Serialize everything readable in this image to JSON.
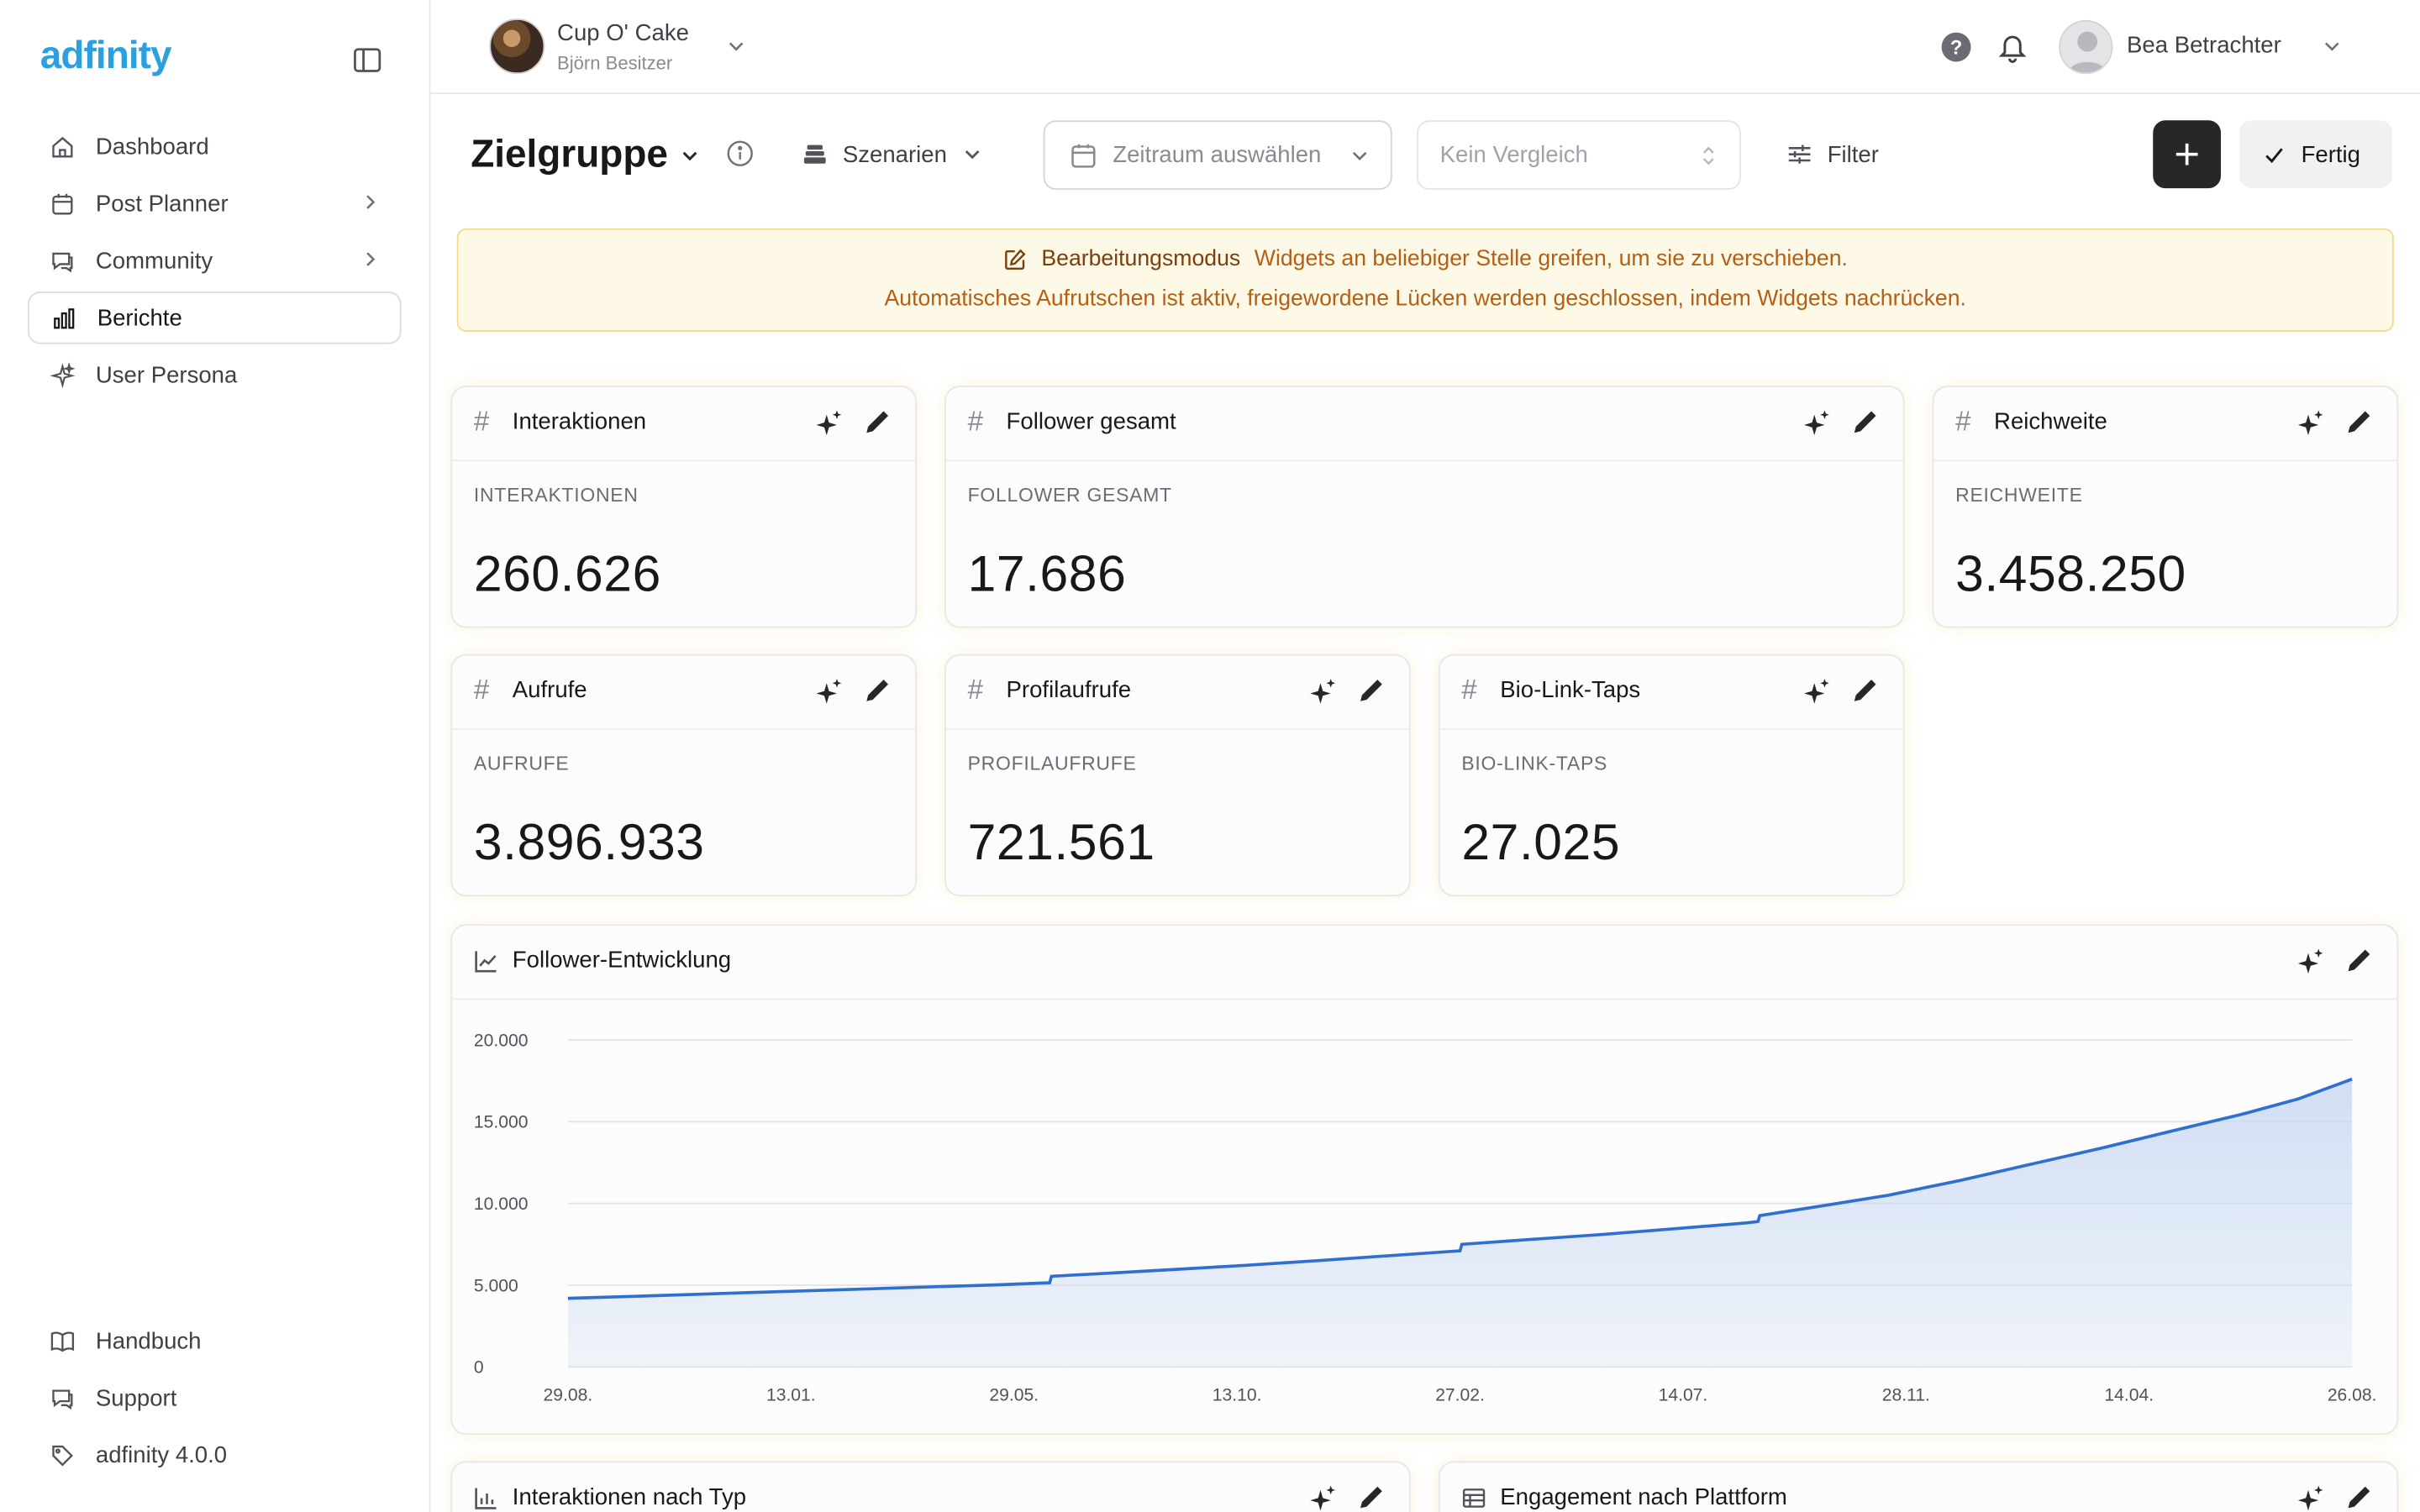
{
  "app": {
    "logo": "adfinity"
  },
  "sidebar": {
    "items": [
      {
        "label": "Dashboard",
        "icon": "home-icon"
      },
      {
        "label": "Post Planner",
        "icon": "calendar-icon"
      },
      {
        "label": "Community",
        "icon": "chat-icon"
      },
      {
        "label": "Berichte",
        "icon": "bar-chart-icon",
        "active": true
      },
      {
        "label": "User Persona",
        "icon": "sparkles-icon"
      }
    ],
    "bottom": [
      {
        "label": "Handbuch",
        "icon": "book-icon"
      },
      {
        "label": "Support",
        "icon": "chat-icon"
      },
      {
        "label": "adfinity 4.0.0",
        "icon": "tag-icon"
      }
    ]
  },
  "topbar": {
    "brand_name": "Cup O' Cake",
    "brand_owner": "Björn Besitzer",
    "help_symbol": "?",
    "user_name": "Bea Betrachter"
  },
  "toolbar": {
    "title": "Zielgruppe",
    "scenarios_label": "Szenarien",
    "range_placeholder": "Zeitraum auswählen",
    "compare_placeholder": "Kein Vergleich",
    "filter_label": "Filter",
    "done_label": "Fertig"
  },
  "banner": {
    "mode_label": "Bearbeitungsmodus",
    "line1": "Widgets an beliebiger Stelle greifen, um sie zu verschieben.",
    "line2": "Automatisches Aufrutschen ist aktiv, freigewordene Lücken werden geschlossen, indem Widgets nachrücken."
  },
  "metrics": [
    {
      "title": "Interaktionen",
      "label": "INTERAKTIONEN",
      "value": "260.626"
    },
    {
      "title": "Follower gesamt",
      "label": "FOLLOWER GESAMT",
      "value": "17.686"
    },
    {
      "title": "Reichweite",
      "label": "REICHWEITE",
      "value": "3.458.250"
    },
    {
      "title": "Aufrufe",
      "label": "AUFRUFE",
      "value": "3.896.933"
    },
    {
      "title": "Profilaufrufe",
      "label": "PROFILAUFRUFE",
      "value": "721.561"
    },
    {
      "title": "Bio-Link-Taps",
      "label": "BIO-LINK-TAPS",
      "value": "27.025"
    }
  ],
  "hash_symbol": "#",
  "follower_chart": {
    "title": "Follower-Entwicklung"
  },
  "bottom_widgets": [
    {
      "title": "Interaktionen nach Typ"
    },
    {
      "title": "Engagement nach Plattform"
    }
  ],
  "colors": {
    "accent": "#2f6fd0",
    "area_fill": "#c9d9f2",
    "banner_bg": "#fef9e6",
    "banner_text": "#b45f16",
    "logo": "#2aa0e0"
  },
  "chart_data": {
    "type": "area",
    "title": "Follower-Entwicklung",
    "xlabel": "",
    "ylabel": "",
    "ylim": [
      0,
      20000
    ],
    "yticks": [
      "0",
      "5.000",
      "10.000",
      "15.000",
      "20.000"
    ],
    "ytick_values": [
      0,
      5000,
      10000,
      15000,
      20000
    ],
    "xticks": [
      "29.08.",
      "13.01.",
      "29.05.",
      "13.10.",
      "27.02.",
      "14.07.",
      "28.11.",
      "14.04.",
      "26.08."
    ],
    "grid": true,
    "legend": "none",
    "series": [
      {
        "x": [
          0,
          0.04,
          0.08,
          0.12,
          0.16,
          0.2,
          0.24,
          0.27,
          0.271,
          0.3,
          0.34,
          0.38,
          0.42,
          0.46,
          0.5,
          0.501,
          0.54,
          0.58,
          0.62,
          0.66,
          0.667,
          0.668,
          0.7,
          0.74,
          0.78,
          0.82,
          0.86,
          0.9,
          0.94,
          0.97,
          1
        ],
        "values": [
          4200,
          4330,
          4470,
          4610,
          4750,
          4890,
          5020,
          5150,
          5550,
          5720,
          5960,
          6220,
          6500,
          6800,
          7100,
          7500,
          7800,
          8100,
          8450,
          8800,
          8900,
          9250,
          9800,
          10500,
          11400,
          12400,
          13400,
          14450,
          15500,
          16400,
          17600
        ]
      }
    ]
  }
}
